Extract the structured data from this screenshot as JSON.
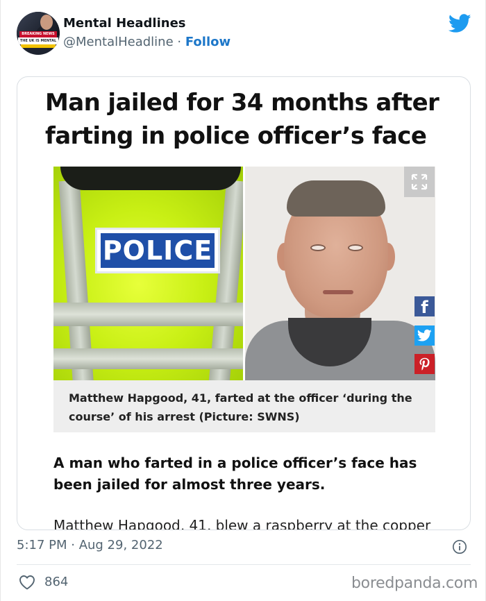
{
  "author": {
    "name": "Mental Headlines",
    "handle": "@MentalHeadline",
    "separator": "·",
    "follow_label": "Follow",
    "avatar": {
      "banner_text": "BREAKING NEWS",
      "headline_text": "THE UK IS MENTAL"
    }
  },
  "article": {
    "headline": "Man jailed for 34 months after farting in police officer’s face",
    "badge_text": "POLICE",
    "caption": "Matthew Hapgood, 41, farted at the officer ‘during the course’ of his arrest (Picture: SWNS)",
    "lead": "A man who farted in a police officer’s face has been jailed for almost three years.",
    "continued": "Matthew Hapgood, 41, blew a raspberry at the copper"
  },
  "share": {
    "facebook_glyph": "f"
  },
  "footer": {
    "timestamp": "5:17 PM · Aug 29, 2022",
    "likes": "864",
    "watermark": "boredpanda.com"
  },
  "colors": {
    "twitter_blue": "#1d9bf0",
    "follow_blue": "#1d77c9",
    "facebook": "#3b5998",
    "twitter_share": "#1da1f2",
    "pinterest": "#cb2027",
    "police_badge": "#1f4fa8"
  },
  "icons": [
    "twitter-bird-icon",
    "expand-icon",
    "facebook-icon",
    "twitter-icon",
    "pinterest-icon",
    "info-icon",
    "heart-icon"
  ]
}
